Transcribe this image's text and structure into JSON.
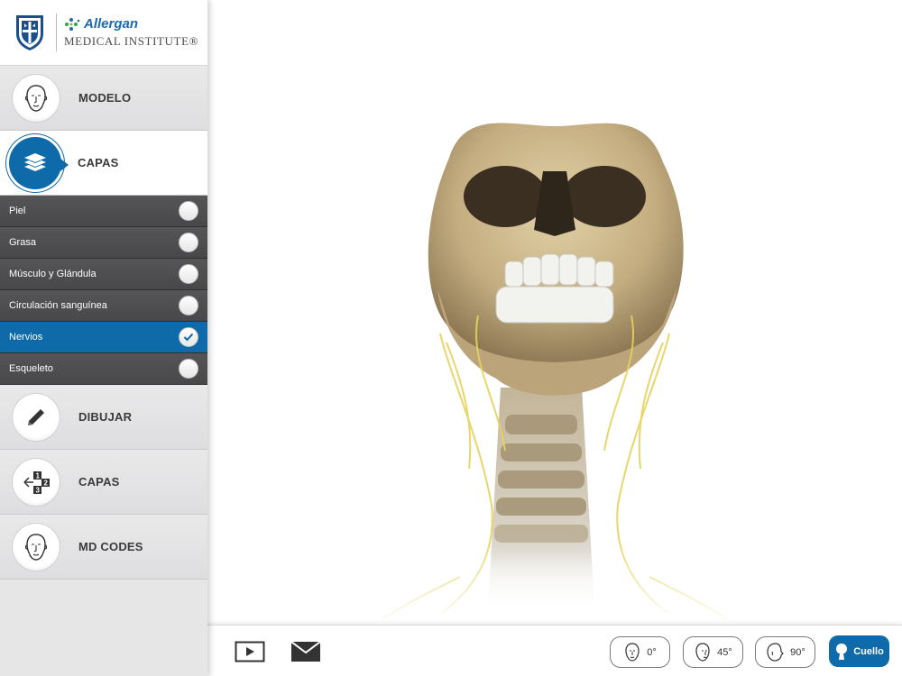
{
  "brand": {
    "name": "Allergan",
    "subtitle": "MEDICAL INSTITUTE®"
  },
  "menu": {
    "modelo": "MODELO",
    "capas": "CAPAS",
    "dibujar": "DIBUJAR",
    "capas2": "CAPAS",
    "mdcodes": "MD CODES"
  },
  "layers": [
    {
      "label": "Piel",
      "checked": false
    },
    {
      "label": "Grasa",
      "checked": false
    },
    {
      "label": "Músculo y Glándula",
      "checked": false
    },
    {
      "label": "Circulación sanguínea",
      "checked": false
    },
    {
      "label": "Nervios",
      "checked": true
    },
    {
      "label": "Esqueleto",
      "checked": false
    }
  ],
  "toolbar": {
    "view_0": "0°",
    "view_45": "45°",
    "view_90": "90°",
    "cuello": "Cuello"
  },
  "colors": {
    "accent": "#0e6aa8",
    "nerve": "#e6d25a",
    "bone": "#c9b388"
  }
}
